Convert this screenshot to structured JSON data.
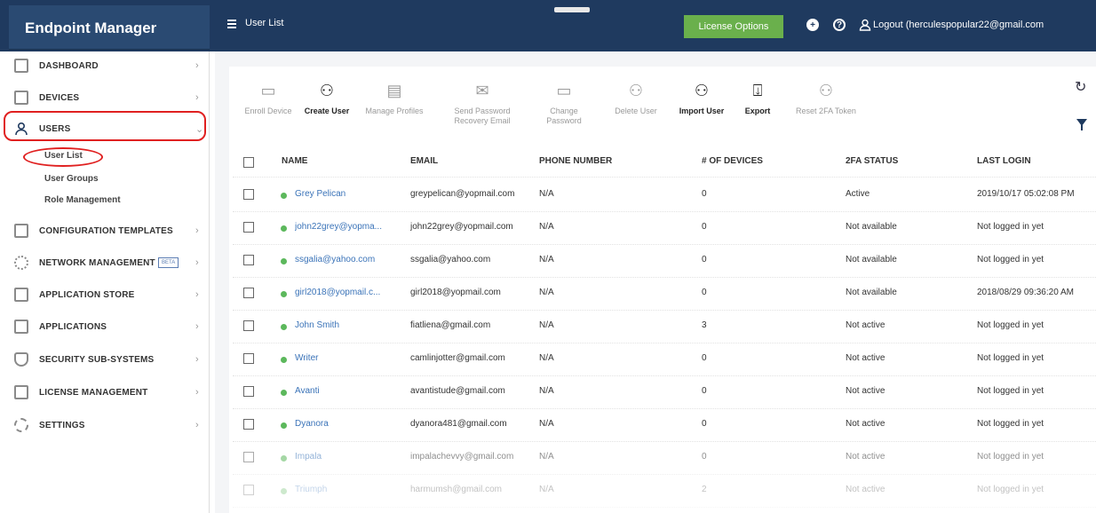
{
  "app": {
    "brand": "Endpoint Manager",
    "page_title": "User List",
    "license_button": "License Options",
    "logout_text": "Logout (herculespopular22@gmail.com"
  },
  "colors": {
    "topbar": "#1f3a5f",
    "license_button": "#6ab04c",
    "highlight_circle": "#e02020",
    "status_dot": "#5cb85c",
    "link": "#3a73b8"
  },
  "sidebar": {
    "items": [
      {
        "label": "DASHBOARD",
        "icon": "dashboard-grid-icon"
      },
      {
        "label": "DEVICES",
        "icon": "devices-icon"
      },
      {
        "label": "USERS",
        "icon": "user-icon"
      },
      {
        "label": "CONFIGURATION TEMPLATES",
        "icon": "template-icon"
      },
      {
        "label": "NETWORK MANAGEMENT",
        "icon": "network-icon",
        "badge": "BETA"
      },
      {
        "label": "APPLICATION STORE",
        "icon": "store-icon"
      },
      {
        "label": "APPLICATIONS",
        "icon": "applications-icon"
      },
      {
        "label": "SECURITY SUB-SYSTEMS",
        "icon": "shield-icon"
      },
      {
        "label": "LICENSE MANAGEMENT",
        "icon": "license-icon"
      },
      {
        "label": "SETTINGS",
        "icon": "gear-icon"
      }
    ],
    "user_sub_items": [
      "User List",
      "User Groups",
      "Role Management"
    ]
  },
  "toolbar": {
    "items": [
      {
        "label": "Enroll Device",
        "icon": "enroll-device-icon",
        "enabled": false
      },
      {
        "label": "Create User",
        "icon": "create-user-icon",
        "enabled": true
      },
      {
        "label": "Manage Profiles",
        "icon": "manage-profiles-icon",
        "enabled": false
      },
      {
        "label": "Send Password Recovery Email",
        "icon": "envelope-icon",
        "enabled": false
      },
      {
        "label": "Change Password",
        "icon": "change-password-icon",
        "enabled": false
      },
      {
        "label": "Delete User",
        "icon": "delete-user-icon",
        "enabled": false
      },
      {
        "label": "Import User",
        "icon": "import-user-icon",
        "enabled": true
      },
      {
        "label": "Export",
        "icon": "export-icon",
        "enabled": true
      },
      {
        "label": "Reset 2FA Token",
        "icon": "reset-2fa-icon",
        "enabled": false
      }
    ]
  },
  "table": {
    "columns": [
      "NAME",
      "EMAIL",
      "PHONE NUMBER",
      "# OF DEVICES",
      "2FA STATUS",
      "LAST LOGIN"
    ],
    "rows": [
      {
        "name": "Grey Pelican",
        "email": "greypelican@yopmail.com",
        "phone": "N/A",
        "devices": "0",
        "twofa": "Active",
        "last_login": "2019/10/17 05:02:08 PM"
      },
      {
        "name": "john22grey@yopma...",
        "email": "john22grey@yopmail.com",
        "phone": "N/A",
        "devices": "0",
        "twofa": "Not available",
        "last_login": "Not logged in yet"
      },
      {
        "name": "ssgalia@yahoo.com",
        "email": "ssgalia@yahoo.com",
        "phone": "N/A",
        "devices": "0",
        "twofa": "Not available",
        "last_login": "Not logged in yet"
      },
      {
        "name": "girl2018@yopmail.c...",
        "email": "girl2018@yopmail.com",
        "phone": "N/A",
        "devices": "0",
        "twofa": "Not available",
        "last_login": "2018/08/29 09:36:20 AM"
      },
      {
        "name": "John Smith",
        "email": "fiatliena@gmail.com",
        "phone": "N/A",
        "devices": "3",
        "twofa": "Not active",
        "last_login": "Not logged in yet"
      },
      {
        "name": "Writer",
        "email": "camlinjotter@gmail.com",
        "phone": "N/A",
        "devices": "0",
        "twofa": "Not active",
        "last_login": "Not logged in yet"
      },
      {
        "name": "Avanti",
        "email": "avantistude@gmail.com",
        "phone": "N/A",
        "devices": "0",
        "twofa": "Not active",
        "last_login": "Not logged in yet"
      },
      {
        "name": "Dyanora",
        "email": "dyanora481@gmail.com",
        "phone": "N/A",
        "devices": "0",
        "twofa": "Not active",
        "last_login": "Not logged in yet"
      },
      {
        "name": "Impala",
        "email": "impalachevvy@gmail.com",
        "phone": "N/A",
        "devices": "0",
        "twofa": "Not active",
        "last_login": "Not logged in yet"
      },
      {
        "name": "Triumph",
        "email": "harmumsh@gmail.com",
        "phone": "N/A",
        "devices": "2",
        "twofa": "Not active",
        "last_login": "Not logged in yet"
      }
    ]
  }
}
